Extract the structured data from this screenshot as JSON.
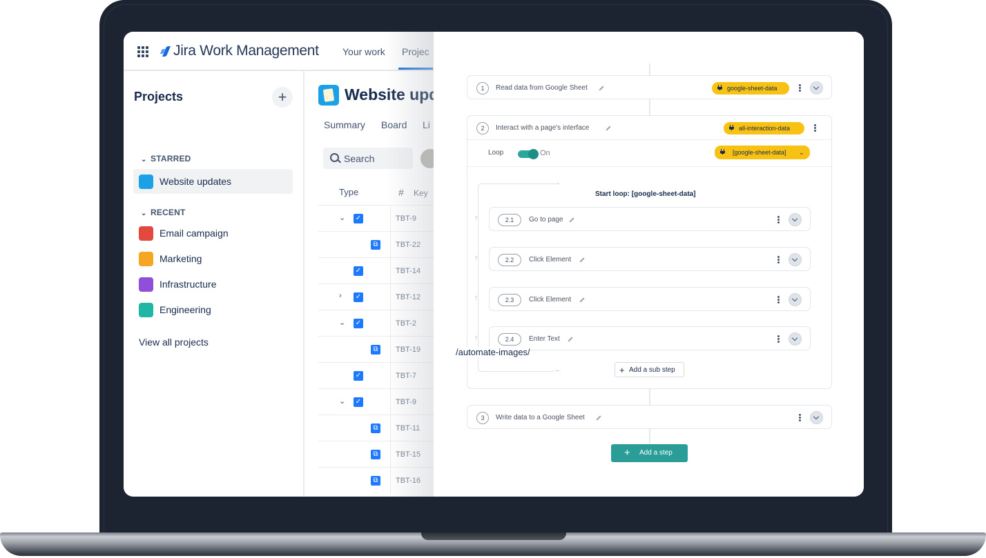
{
  "jira": {
    "brand": "Jira Work Management",
    "nav": [
      "Your work",
      "Projec"
    ],
    "sidebar": {
      "title": "Projects",
      "add_label": "+",
      "starred_label": "STARRED",
      "starred": [
        {
          "label": "Website updates",
          "color": "#1ba2e6"
        }
      ],
      "recent_label": "RECENT",
      "recent": [
        {
          "label": "Email campaign",
          "color": "#e2483d"
        },
        {
          "label": "Marketing",
          "color": "#f5a623"
        },
        {
          "label": "Infrastructure",
          "color": "#8f4fd8"
        },
        {
          "label": "Engineering",
          "color": "#1fb6a6"
        }
      ],
      "view_all": "View all projects"
    },
    "project_title": "Website upd",
    "tabs": [
      "Summary",
      "Board",
      "Li"
    ],
    "search_placeholder": "Search",
    "columns": {
      "type": "Type",
      "hash": "#",
      "key": "Key"
    },
    "rows": [
      {
        "chevron": "⌄",
        "icon": "task",
        "key": "TBT-9"
      },
      {
        "chevron": "",
        "icon": "subtask",
        "key": "TBT-22"
      },
      {
        "chevron": "",
        "icon": "task",
        "key": "TBT-14"
      },
      {
        "chevron": "›",
        "icon": "task",
        "key": "TBT-12"
      },
      {
        "chevron": "⌄",
        "icon": "task",
        "key": "TBT-2"
      },
      {
        "chevron": "",
        "icon": "subtask",
        "key": "TBT-19"
      },
      {
        "chevron": "",
        "icon": "task",
        "key": "TBT-7"
      },
      {
        "chevron": "⌄",
        "icon": "task",
        "key": "TBT-9"
      },
      {
        "chevron": "",
        "icon": "subtask",
        "key": "TBT-11"
      },
      {
        "chevron": "",
        "icon": "subtask",
        "key": "TBT-15"
      },
      {
        "chevron": "",
        "icon": "subtask",
        "key": "TBT-16"
      }
    ]
  },
  "automation": {
    "steps": [
      {
        "num": "1",
        "label": "Read data from Google Sheet",
        "badge": "google-sheet-data"
      },
      {
        "num": "2",
        "label": "Interact with a page's interface",
        "badge": "all-interaction-data"
      },
      {
        "num": "3",
        "label": "Write data to a Google Sheet",
        "badge": ""
      }
    ],
    "loop": {
      "label": "Loop",
      "toggle_state": "On",
      "source_badge": "[google-sheet-data]",
      "start_label": "Start loop: [google-sheet-data]",
      "substeps": [
        {
          "num": "2.1",
          "label": "Go to page"
        },
        {
          "num": "2.2",
          "label": "Click Element"
        },
        {
          "num": "2.3",
          "label": "Click Element"
        },
        {
          "num": "2.4",
          "label": "Enter Text"
        }
      ],
      "add_sub_step": "Add a sub step"
    },
    "add_step": "Add a step",
    "accent_color": "#2a9d97",
    "badge_color": "#f7c213"
  },
  "overlay_text": "/automate-images/"
}
